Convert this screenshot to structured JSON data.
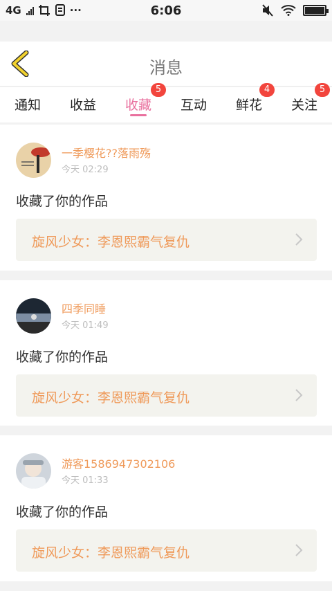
{
  "status_bar": {
    "network": "4G",
    "time": "6:06",
    "more": "···"
  },
  "header": {
    "title": "消息"
  },
  "tabs": [
    {
      "label": "通知",
      "badge": ""
    },
    {
      "label": "收益",
      "badge": ""
    },
    {
      "label": "收藏",
      "badge": "5",
      "active": true
    },
    {
      "label": "互动",
      "badge": ""
    },
    {
      "label": "鲜花",
      "badge": "4"
    },
    {
      "label": "关注",
      "badge": "5"
    }
  ],
  "messages": [
    {
      "user": "一季樱花??落雨殇",
      "time": "今天 02:29",
      "action": "收藏了你的作品",
      "work": "旋风少女：李恩熙霸气复仇"
    },
    {
      "user": "四季同睡",
      "time": "今天 01:49",
      "action": "收藏了你的作品",
      "work": "旋风少女：李恩熙霸气复仇"
    },
    {
      "user": "游客1586947302106",
      "time": "今天 01:33",
      "action": "收藏了你的作品",
      "work": "旋风少女：李恩熙霸气复仇"
    }
  ],
  "colors": {
    "accent_pink": "#e9709e",
    "name_orange": "#ef9a5a",
    "badge_red": "#f2453d",
    "back_yellow": "#f2d22e"
  },
  "icons": {
    "back": "chevron-left-icon",
    "work_arrow": "chevron-right-icon"
  }
}
